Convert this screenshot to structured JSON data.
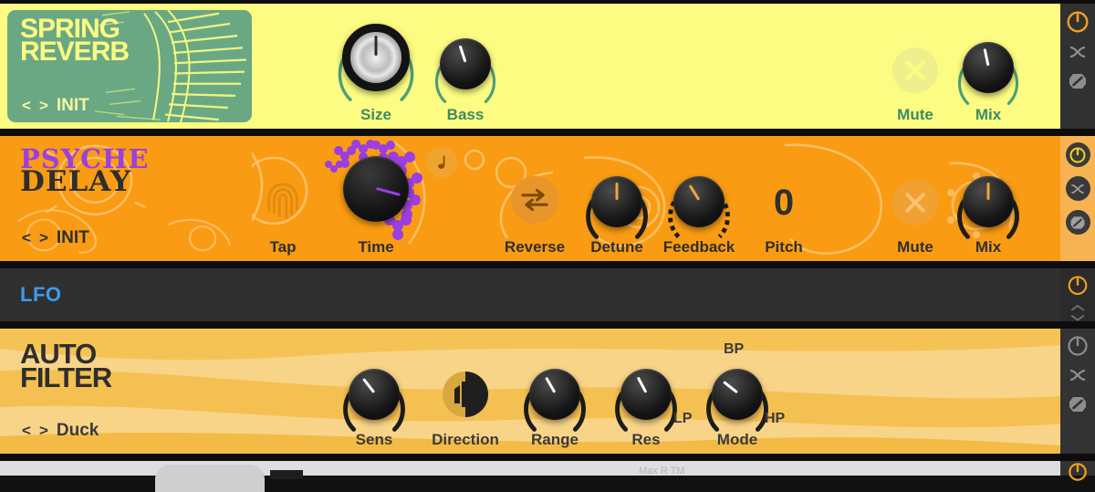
{
  "devices": [
    {
      "id": "reverb",
      "title_lines": [
        "SPRING",
        "REVERB"
      ],
      "preset": "INIT",
      "prev_label": "<",
      "next_label": ">",
      "enabled": true,
      "controls": [
        {
          "name": "size",
          "label": "Size",
          "type": "knob",
          "angle": 0,
          "size": "large"
        },
        {
          "name": "bass",
          "label": "Bass",
          "type": "knob",
          "angle": -18,
          "size": "small"
        },
        {
          "name": "mute",
          "label": "Mute",
          "type": "button",
          "icon": "x-icon"
        },
        {
          "name": "mix",
          "label": "Mix",
          "type": "knob",
          "angle": -12,
          "size": "small"
        }
      ],
      "rail_icons": [
        "power-icon",
        "crossfade-icon",
        "bypass-icon"
      ],
      "accent": "#3f8a63"
    },
    {
      "id": "delay",
      "title_lines": [
        "PSYCHE",
        "DELAY"
      ],
      "preset": "INIT",
      "prev_label": "<",
      "next_label": ">",
      "enabled": true,
      "controls": [
        {
          "name": "tap",
          "label": "Tap",
          "type": "button",
          "icon": "fingerprint-icon"
        },
        {
          "name": "time",
          "label": "Time",
          "type": "knob",
          "angle": 105,
          "size": "large"
        },
        {
          "name": "sync",
          "label": "",
          "type": "button",
          "icon": "note-icon"
        },
        {
          "name": "reverse",
          "label": "Reverse",
          "type": "button",
          "icon": "reverse-arrows-icon"
        },
        {
          "name": "detune",
          "label": "Detune",
          "type": "knob",
          "angle": 0,
          "size": "small"
        },
        {
          "name": "feedback",
          "label": "Feedback",
          "type": "knob",
          "angle": -32,
          "size": "small"
        },
        {
          "name": "pitch",
          "label": "Pitch",
          "type": "value",
          "value": "0"
        },
        {
          "name": "mute",
          "label": "Mute",
          "type": "button",
          "icon": "x-icon"
        },
        {
          "name": "mix",
          "label": "Mix",
          "type": "knob",
          "angle": 0,
          "size": "small"
        }
      ],
      "rail_icons": [
        "power-icon",
        "crossfade-icon",
        "bypass-icon"
      ],
      "accent": "#2f2f2f"
    },
    {
      "id": "lfo",
      "title_lines": [
        "LFO"
      ],
      "enabled": true,
      "collapsed": true,
      "rail_icons": [
        "power-icon",
        "expand-icon"
      ],
      "accent": "#3e9bf0"
    },
    {
      "id": "filter",
      "title_lines": [
        "AUTO",
        "FILTER"
      ],
      "preset": "Duck",
      "prev_label": "<",
      "next_label": ">",
      "enabled": false,
      "controls": [
        {
          "name": "sens",
          "label": "Sens",
          "type": "knob",
          "angle": -38,
          "size": "small"
        },
        {
          "name": "direction",
          "label": "Direction",
          "type": "button",
          "icon": "direction-split-icon"
        },
        {
          "name": "range",
          "label": "Range",
          "type": "knob",
          "angle": -30,
          "size": "small"
        },
        {
          "name": "res",
          "label": "Res",
          "type": "knob",
          "angle": -28,
          "size": "small"
        },
        {
          "name": "mode",
          "label": "Mode",
          "type": "knob",
          "angle": -52,
          "size": "small",
          "ticks": [
            "LP",
            "BP",
            "HP"
          ]
        }
      ],
      "rail_icons": [
        "power-icon",
        "crossfade-icon",
        "bypass-icon"
      ],
      "accent": "#3a3a3a"
    }
  ],
  "mode_ticks": {
    "left": "LP",
    "top": "BP",
    "right": "HP"
  },
  "pitch_value": "0",
  "bottom_strip": {
    "ghost_text": "Max R TM"
  },
  "colors": {
    "reverb_bg": "#fcfc82",
    "reverb_card": "#6aa883",
    "reverb_accent": "#3f8a63",
    "delay_bg": "#f99c13",
    "delay_purple": "#9b3fe0",
    "delay_rail": "#f7b352",
    "lfo_bg": "#303030",
    "lfo_text": "#3e9bf0",
    "filter_bg": "#f6c969",
    "filter_text": "#2e2e2e",
    "power_on": "#f2a01e",
    "power_off": "#8d8d8d"
  }
}
